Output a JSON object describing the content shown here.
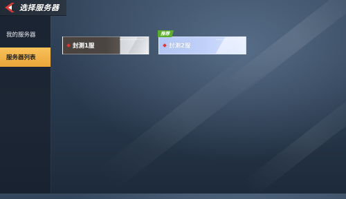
{
  "header": {
    "title": "选择服务器",
    "back_icon": "back-arrow-icon"
  },
  "sidebar": {
    "items": [
      {
        "label": "我的服务器",
        "selected": false
      },
      {
        "label": "服务器列表",
        "selected": true
      }
    ]
  },
  "servers": [
    {
      "name": "封测1服",
      "status_color": "#e2332f",
      "recommended": false
    },
    {
      "name": "封测2服",
      "status_color": "#e2332f",
      "recommended": true,
      "badge": "推荐"
    }
  ],
  "colors": {
    "selected_tab": "#f4b449",
    "badge_green": "#5cae2d",
    "status_dot": "#e2332f"
  }
}
